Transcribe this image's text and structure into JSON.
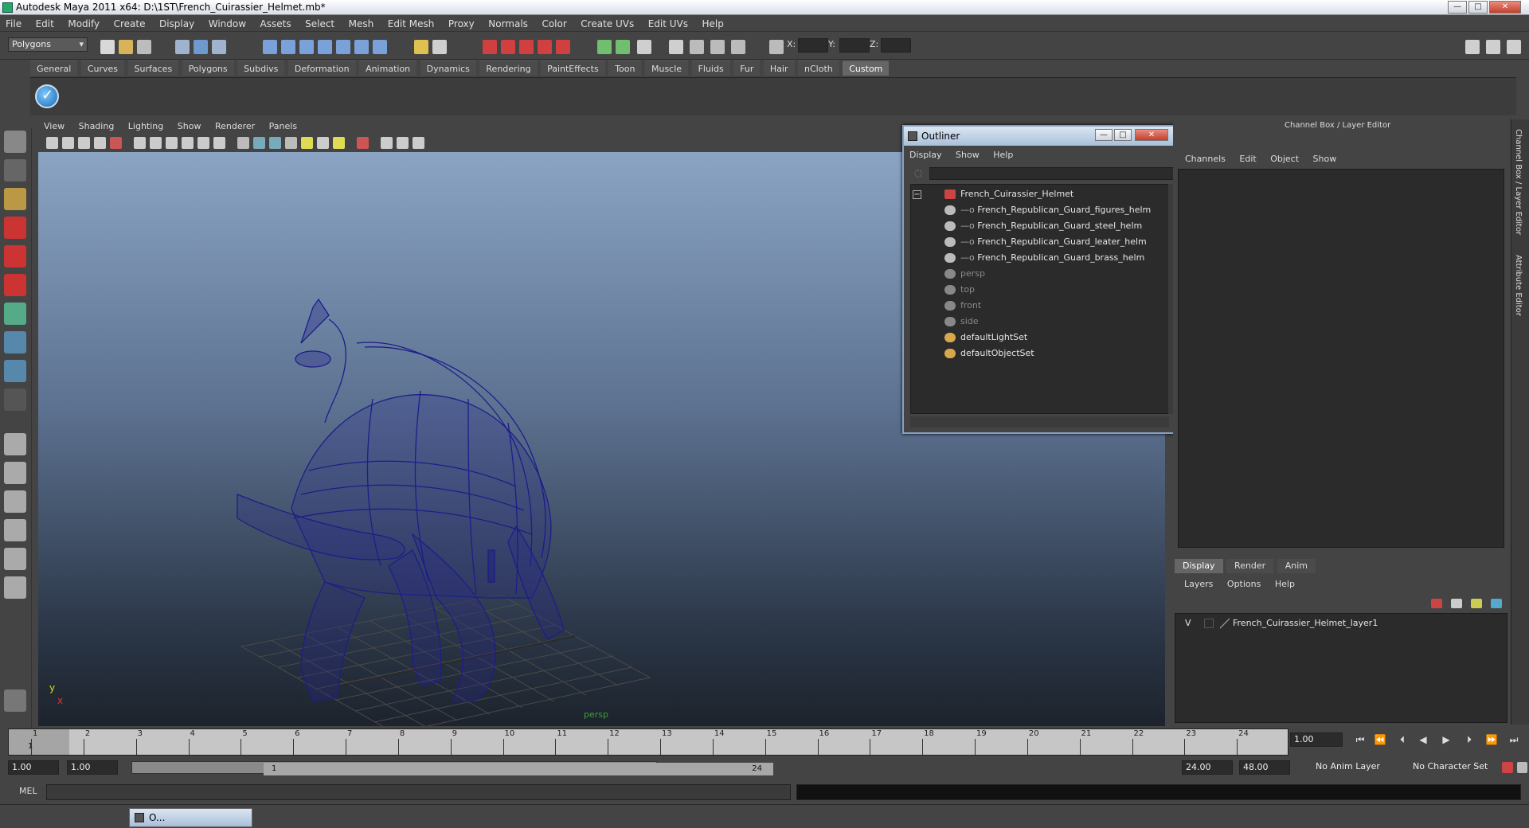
{
  "window": {
    "title": "Autodesk Maya 2011 x64: D:\\1ST\\French_Cuirassier_Helmet.mb*",
    "min": "—",
    "max": "□",
    "close": "✕"
  },
  "menu": [
    "File",
    "Edit",
    "Modify",
    "Create",
    "Display",
    "Window",
    "Assets",
    "Select",
    "Mesh",
    "Edit Mesh",
    "Proxy",
    "Normals",
    "Color",
    "Create UVs",
    "Edit UVs",
    "Help"
  ],
  "status": {
    "mode": "Polygons",
    "x_label": "X:",
    "y_label": "Y:",
    "z_label": "Z:"
  },
  "shelf": {
    "tabs": [
      "General",
      "Curves",
      "Surfaces",
      "Polygons",
      "Subdivs",
      "Deformation",
      "Animation",
      "Dynamics",
      "Rendering",
      "PaintEffects",
      "Toon",
      "Muscle",
      "Fluids",
      "Fur",
      "Hair",
      "nCloth",
      "Custom"
    ],
    "active": "Custom"
  },
  "panel": {
    "menu": [
      "View",
      "Shading",
      "Lighting",
      "Show",
      "Renderer",
      "Panels"
    ],
    "camera": "persp",
    "axis_x": "x",
    "axis_y": "y"
  },
  "outliner": {
    "title": "Outliner",
    "menu": [
      "Display",
      "Show",
      "Help"
    ],
    "collapse": "−",
    "items": [
      {
        "label": "French_Cuirassier_Helmet",
        "depth": 0,
        "dim": false,
        "kind": "group"
      },
      {
        "label": "French_Republican_Guard_figures_helm",
        "depth": 1,
        "dim": false,
        "kind": "mesh"
      },
      {
        "label": "French_Republican_Guard_steel_helm",
        "depth": 1,
        "dim": false,
        "kind": "mesh"
      },
      {
        "label": "French_Republican_Guard_leater_helm",
        "depth": 1,
        "dim": false,
        "kind": "mesh"
      },
      {
        "label": "French_Republican_Guard_brass_helm",
        "depth": 1,
        "dim": false,
        "kind": "mesh"
      },
      {
        "label": "persp",
        "depth": 0,
        "dim": true,
        "kind": "camera"
      },
      {
        "label": "top",
        "depth": 0,
        "dim": true,
        "kind": "camera"
      },
      {
        "label": "front",
        "depth": 0,
        "dim": true,
        "kind": "camera"
      },
      {
        "label": "side",
        "depth": 0,
        "dim": true,
        "kind": "camera"
      },
      {
        "label": "defaultLightSet",
        "depth": 0,
        "dim": false,
        "kind": "set"
      },
      {
        "label": "defaultObjectSet",
        "depth": 0,
        "dim": false,
        "kind": "set"
      }
    ]
  },
  "channelbox": {
    "title": "Channel Box / Layer Editor",
    "menu": [
      "Channels",
      "Edit",
      "Object",
      "Show"
    ]
  },
  "sidebar": {
    "tab1": "Channel Box / Layer Editor",
    "tab2": "Attribute Editor"
  },
  "layers": {
    "tabs": [
      "Display",
      "Render",
      "Anim"
    ],
    "active": "Display",
    "menu": [
      "Layers",
      "Options",
      "Help"
    ],
    "visible_flag": "V",
    "layer_name": "French_Cuirassier_Helmet_layer1"
  },
  "timeline": {
    "start": 1,
    "end": 24,
    "current": "1",
    "current_time": "1.00"
  },
  "range": {
    "start_time": "1.00",
    "start_range": "1.00",
    "range_start_label": "1",
    "range_end_label": "24",
    "end_range": "24.00",
    "end_time": "48.00",
    "anim_layer": "No Anim Layer",
    "char_set": "No Character Set"
  },
  "mel": {
    "label": "MEL"
  },
  "taskbar": {
    "minimized_label": "O..."
  },
  "colors": {
    "wire": "#1d1d8a",
    "grid": "#4a4a4a",
    "accent": "#5d8fd6"
  }
}
